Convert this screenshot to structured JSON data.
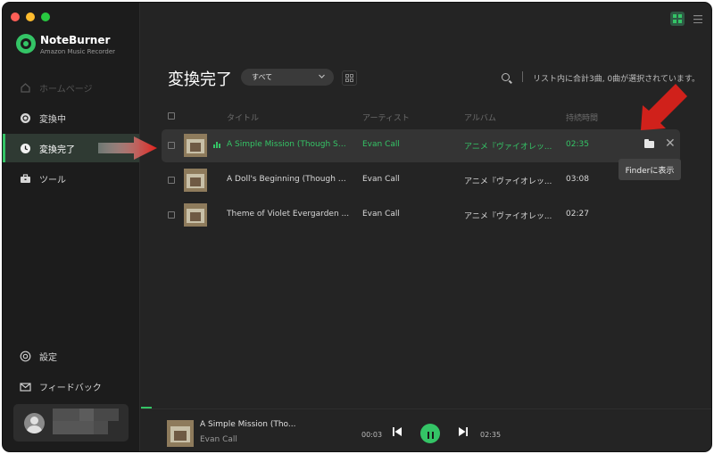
{
  "app": {
    "name": "NoteBurner",
    "subtitle": "Amazon Music Recorder",
    "accent": "#34c466"
  },
  "sidebar": {
    "items": [
      {
        "label": "ホームページ",
        "icon": "home-icon",
        "state": "faded"
      },
      {
        "label": "変換中",
        "icon": "converting-icon",
        "state": "normal"
      },
      {
        "label": "変換完了",
        "icon": "clock-icon",
        "state": "active"
      },
      {
        "label": "ツール",
        "icon": "toolbox-icon",
        "state": "normal"
      }
    ],
    "bottom": [
      {
        "label": "設定",
        "icon": "settings-icon"
      },
      {
        "label": "フィードバック",
        "icon": "mail-icon"
      }
    ]
  },
  "main": {
    "title": "変換完了",
    "filter_value": "すべて",
    "status": "リスト内に合計3曲, 0曲が選択されています。",
    "columns": [
      "タイトル",
      "アーティスト",
      "アルバム",
      "持続時間"
    ],
    "rows": [
      {
        "title": "A Simple Mission (Though Se...",
        "artist": "Evan Call",
        "album": "アニメ『ヴァイオレッ...",
        "duration": "02:35",
        "playing": true
      },
      {
        "title": "A Doll's Beginning (Though S...",
        "artist": "Evan Call",
        "album": "アニメ『ヴァイオレッ...",
        "duration": "03:08",
        "playing": false
      },
      {
        "title": "Theme of Violet Evergarden ...",
        "artist": "Evan Call",
        "album": "アニメ『ヴァイオレッ...",
        "duration": "02:27",
        "playing": false
      }
    ],
    "tooltip": "Finderに表示"
  },
  "player": {
    "title": "A Simple Mission (Tho...",
    "artist": "Evan Call",
    "elapsed": "00:03",
    "total": "02:35"
  }
}
